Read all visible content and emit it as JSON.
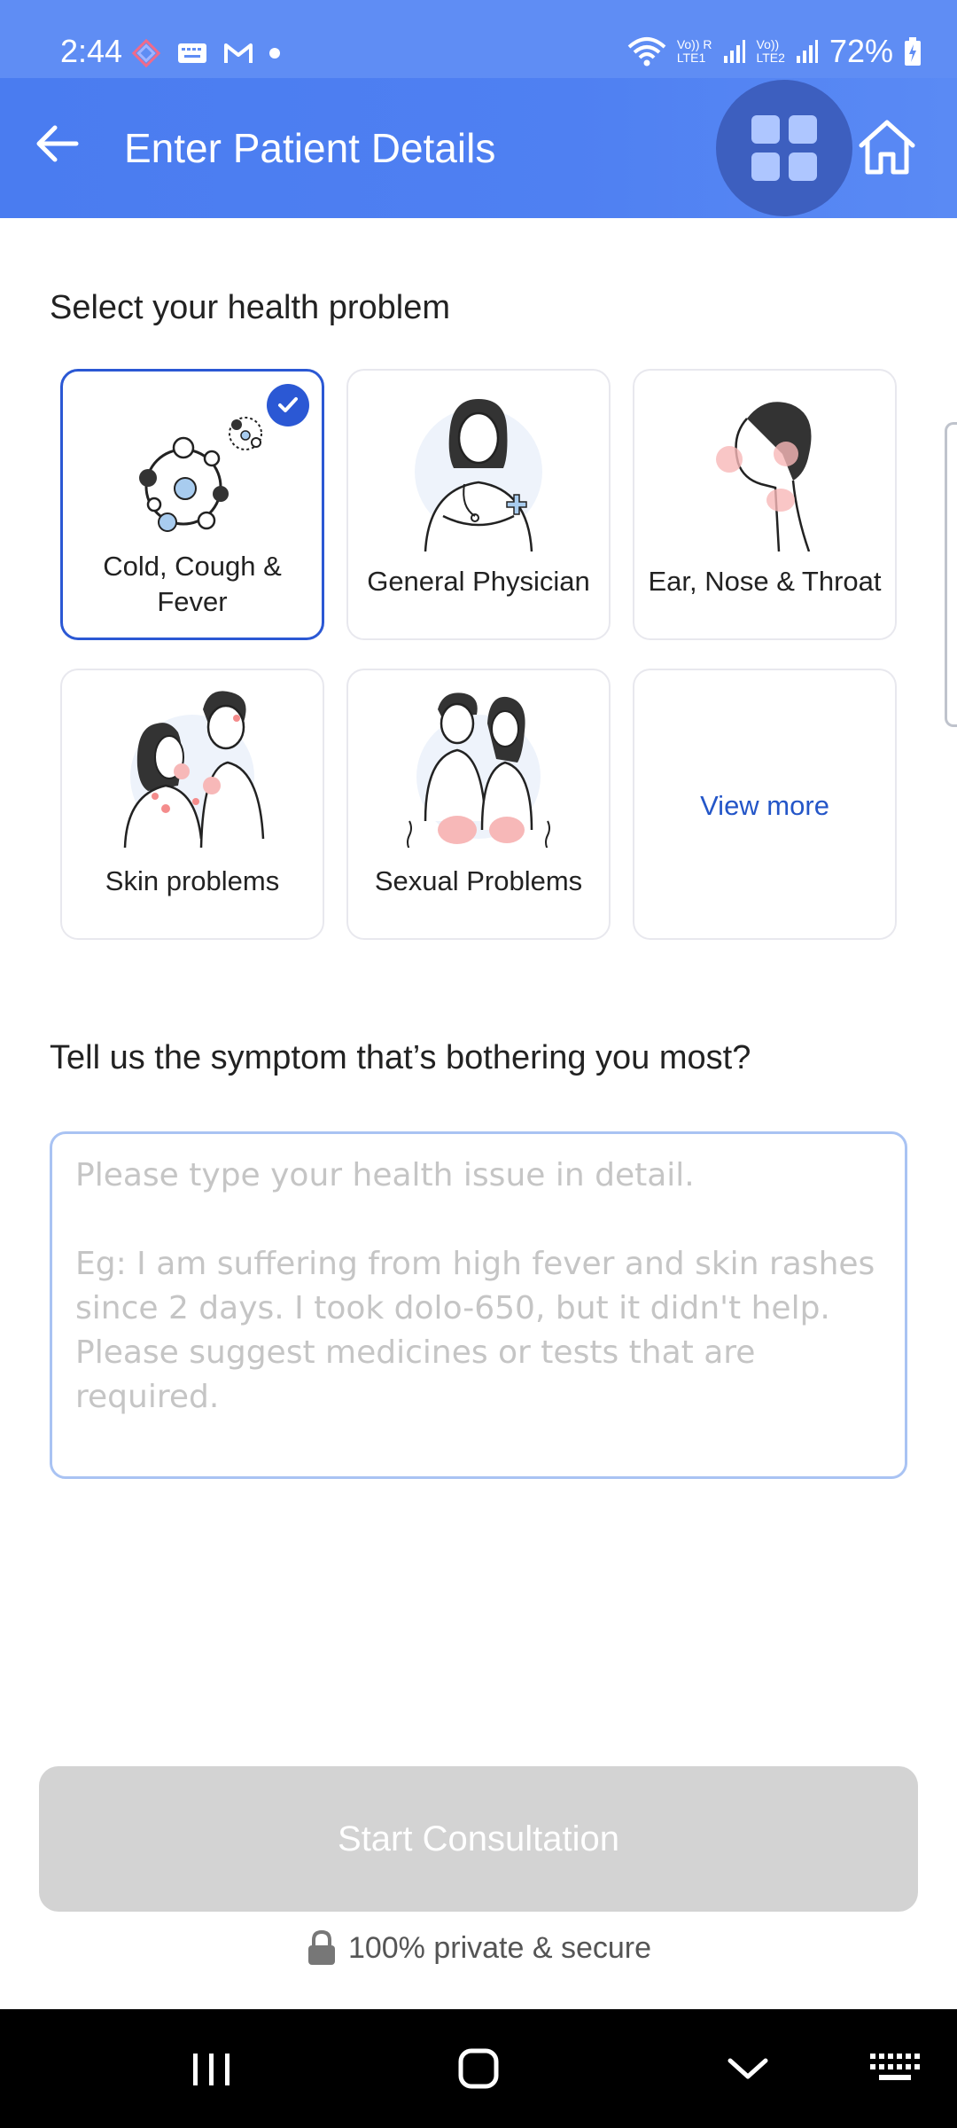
{
  "status_bar": {
    "time": "2:44",
    "network_1_top": "Vo)) R",
    "network_1_bottom": "LTE1",
    "network_2_top": "Vo))",
    "network_2_bottom": "LTE2",
    "battery": "72%",
    "icons": [
      "app-notification-icon",
      "keyboard-icon",
      "gmail-icon",
      "dot-icon",
      "wifi-icon",
      "signal-icon",
      "battery-charging-icon"
    ]
  },
  "app_bar": {
    "title": "Enter Patient Details",
    "back_icon": "back-arrow-icon",
    "grid_icon": "apps-grid-icon",
    "home_icon": "home-icon"
  },
  "problems": {
    "heading": "Select your health problem",
    "items": [
      {
        "label": "Cold, Cough &\nFever",
        "selected": true
      },
      {
        "label": "General Physician",
        "selected": false
      },
      {
        "label": "Ear, Nose & Throat",
        "selected": false
      },
      {
        "label": "Skin problems",
        "selected": false
      },
      {
        "label": "Sexual Problems",
        "selected": false
      }
    ],
    "view_more": "View more"
  },
  "symptom": {
    "heading": "Tell us the symptom that’s bothering you most?",
    "placeholder": "Please type your health issue in detail.\n\nEg: I am suffering from high fever and skin rashes since 2 days. I took dolo-650, but it didn't help. Please suggest medicines or tests that are required."
  },
  "start_button": "Start Consultation",
  "secure_note": "100% private & secure",
  "colors": {
    "primary": "#2b58d4",
    "app_bar": "#4f80f2",
    "disabled_button": "#d3d3d3"
  }
}
